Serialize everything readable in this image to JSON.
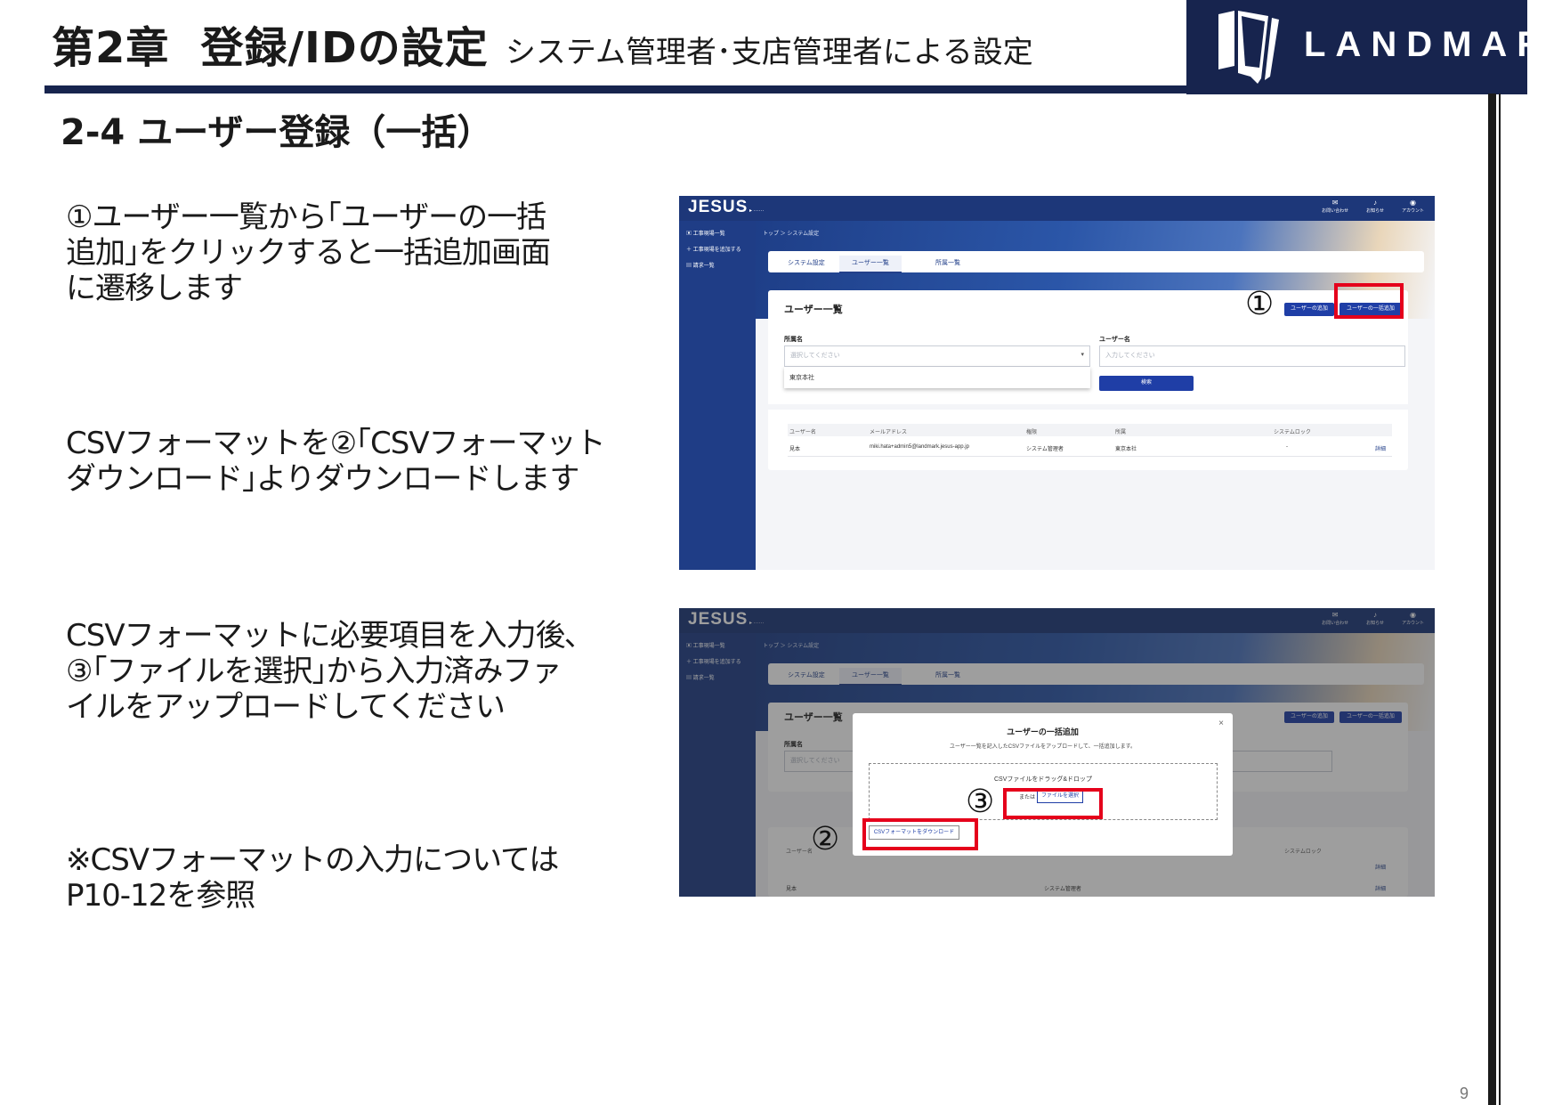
{
  "header": {
    "chapter": "第2章",
    "title": "登録/IDの設定",
    "subtitle": "システム管理者･支店管理者による設定",
    "logo_text": "LANDMARK"
  },
  "section_title": "2-4 ユーザー登録（一括）",
  "descriptions": {
    "d1": [
      "①ユーザー一覧から｢ユーザーの一括",
      "追加｣をクリックすると一括追加画面",
      "に遷移します"
    ],
    "d2": [
      "CSVフォーマットを②｢CSVフォーマット",
      "ダウンロード｣よりダウンロードします"
    ],
    "d3": [
      "CSVフォーマットに必要項目を入力後､",
      "③｢ファイルを選択｣から入力済みファ",
      "イルをアップロードしてください"
    ],
    "d4": [
      "※CSVフォーマットの入力については",
      "P10-12を参照"
    ]
  },
  "page_number": "9",
  "app": {
    "brand": "JESUS",
    "topnav": [
      {
        "icon": "mail-icon",
        "label": "お問い合わせ"
      },
      {
        "icon": "bell-icon",
        "label": "お知らせ"
      },
      {
        "icon": "account-icon",
        "label": "アカウント"
      }
    ],
    "sidebar": [
      "工事現場一覧",
      "工事現場を追加する",
      "請求一覧"
    ],
    "breadcrumb": "トップ ＞ システム設定",
    "tabs": [
      "システム設定",
      "ユーザー一覧",
      "所属一覧"
    ],
    "panel_title": "ユーザー一覧",
    "add_user": "ユーザーの追加",
    "bulk_add": "ユーザーの一括追加",
    "field_org_label": "所属名",
    "field_org_placeholder": "選択してください",
    "field_user_label": "ユーザー名",
    "field_user_placeholder": "入力してください",
    "dropdown_option": "東京本社",
    "search_button": "検索",
    "table_headers": [
      "ユーザー名",
      "メールアドレス",
      "権限",
      "所属",
      "システムロック"
    ],
    "table_row": [
      "見本",
      "miki.hata+admin5@landmark.jesus-app.jp",
      "システム管理者",
      "東京本社",
      "-",
      "詳細"
    ]
  },
  "modal": {
    "title": "ユーザーの一括追加",
    "description": "ユーザー一覧を記入したCSVファイルをアップロードして、一括追加します。",
    "drop_text": "CSVファイルをドラッグ&ドロップ",
    "or_text": "または",
    "file_button": "ファイルを選択",
    "download_button": "CSVフォーマットをダウンロード",
    "close": "×"
  },
  "shot2_rows": [
    {
      "name": "見本",
      "role": "システム管理者",
      "detail": "詳細"
    }
  ],
  "markers": {
    "m1": "①",
    "m2": "②",
    "m3": "③"
  },
  "colors": {
    "navy": "#17244e",
    "app_blue": "#1f3ea6",
    "highlight_red": "#e5001b"
  }
}
